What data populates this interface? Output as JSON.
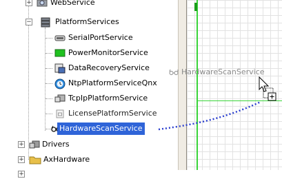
{
  "tree": {
    "web_service": "WebService",
    "platform_services": "PlatformServices",
    "children": [
      {
        "label": "SerialPortService",
        "icon": "serial-port-icon"
      },
      {
        "label": "PowerMonitorService",
        "icon": "power-monitor-icon"
      },
      {
        "label": "DataRecoveryService",
        "icon": "data-recovery-icon"
      },
      {
        "label": "NtpPlatformServiceQnx",
        "icon": "ntp-clock-icon"
      },
      {
        "label": "TcpIpPlatformService",
        "icon": "tcpip-icon"
      },
      {
        "label": "LicensePlatformService",
        "icon": "license-icon"
      },
      {
        "label": "HardwareScanService",
        "icon": "glasses-icon",
        "selected": true
      }
    ],
    "drivers": "Drivers",
    "ax_hardware": "AxHardware"
  },
  "drag": {
    "ghost_label": "HardwareScanService",
    "ghost_icon": "glasses-icon",
    "cursor": "drag-copy-cursor-icon"
  },
  "colors": {
    "selection": "#2f64d8",
    "drag_line": "#2a3ecf",
    "canvas_edge": "#38d438",
    "folder": "#e8c04a"
  }
}
